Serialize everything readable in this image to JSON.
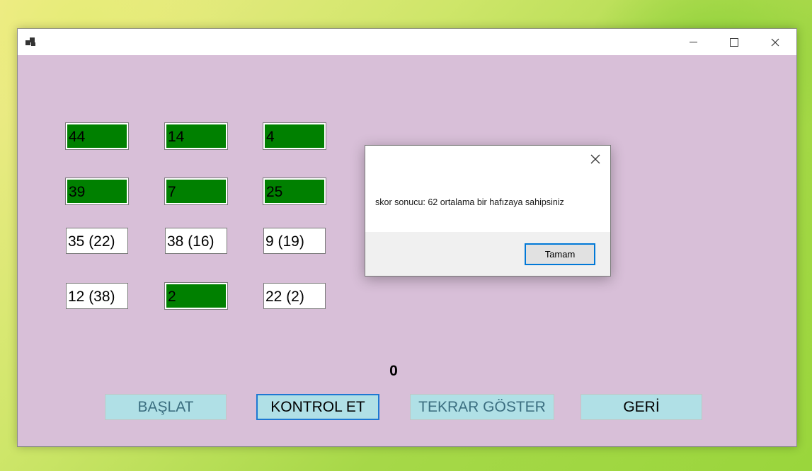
{
  "window": {
    "controls": {
      "minimize_icon": "minimize-icon",
      "maximize_icon": "maximize-icon",
      "close_icon": "close-icon"
    }
  },
  "grid": {
    "cells": [
      {
        "text": "44",
        "state": "correct"
      },
      {
        "text": "14",
        "state": "correct"
      },
      {
        "text": "4",
        "state": "correct"
      },
      {
        "text": "39",
        "state": "correct"
      },
      {
        "text": "7",
        "state": "correct"
      },
      {
        "text": "25",
        "state": "correct"
      },
      {
        "text": "35 (22)",
        "state": "wrong"
      },
      {
        "text": "38 (16)",
        "state": "wrong"
      },
      {
        "text": "9 (19)",
        "state": "wrong"
      },
      {
        "text": "12 (38)",
        "state": "wrong"
      },
      {
        "text": "2",
        "state": "correct"
      },
      {
        "text": "22 (2)",
        "state": "wrong"
      }
    ]
  },
  "score": "0",
  "buttons": {
    "start": "BAŞLAT",
    "check": "KONTROL ET",
    "replay": "TEKRAR GÖSTER",
    "back": "GERİ"
  },
  "dialog": {
    "message": "skor sonucu: 62 ortalama bir hafızaya sahipsiniz",
    "ok_label": "Tamam",
    "close_symbol": "✕"
  },
  "colors": {
    "form_background": "#d8bfd8",
    "correct_cell": "#008000",
    "button_background": "#b0e0e6",
    "focus_border": "#0078d7"
  }
}
